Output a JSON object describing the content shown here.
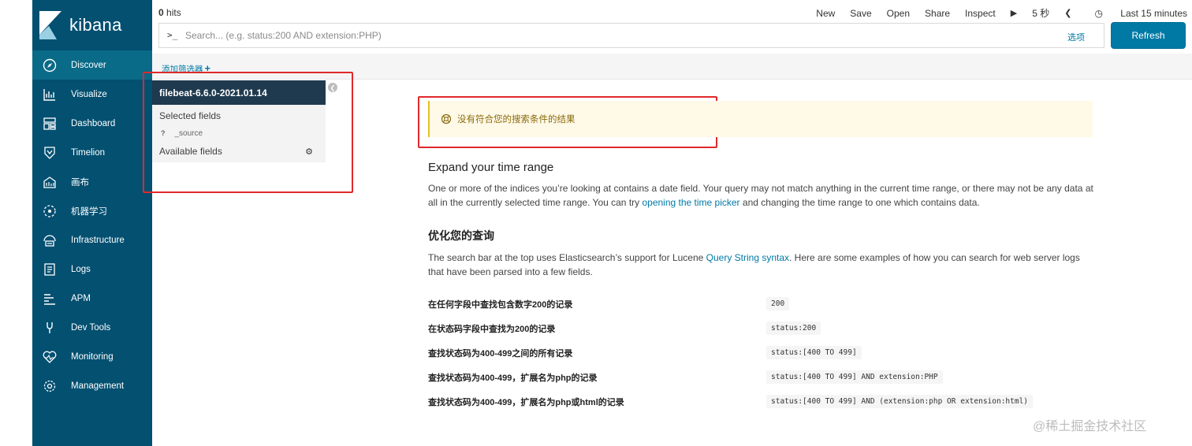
{
  "app": {
    "logo_text": "kibana"
  },
  "sidebar": {
    "items": [
      {
        "label": "Discover",
        "icon": "compass-icon"
      },
      {
        "label": "Visualize",
        "icon": "chart-icon"
      },
      {
        "label": "Dashboard",
        "icon": "dashboard-icon"
      },
      {
        "label": "Timelion",
        "icon": "shield-icon"
      },
      {
        "label": "画布",
        "icon": "canvas-icon"
      },
      {
        "label": "机器学习",
        "icon": "ml-icon"
      },
      {
        "label": "Infrastructure",
        "icon": "infrastructure-icon"
      },
      {
        "label": "Logs",
        "icon": "logs-icon"
      },
      {
        "label": "APM",
        "icon": "apm-icon"
      },
      {
        "label": "Dev Tools",
        "icon": "wrench-icon"
      },
      {
        "label": "Monitoring",
        "icon": "heartbeat-icon"
      },
      {
        "label": "Management",
        "icon": "gear-icon"
      }
    ]
  },
  "topbar": {
    "hits_count": "0",
    "hits_label": "hits",
    "menu": {
      "new": "New",
      "save": "Save",
      "open": "Open",
      "share": "Share",
      "inspect": "Inspect"
    },
    "refresh_interval": "5 秒",
    "time_range": "Last 15 minutes"
  },
  "search": {
    "prompt": ">_",
    "placeholder": "Search... (e.g. status:200 AND extension:PHP)",
    "options_label": "选项",
    "refresh_label": "Refresh"
  },
  "filter": {
    "add_label": "添加筛选器"
  },
  "fields": {
    "index_pattern": "filebeat-6.6.0-2021.01.14",
    "selected_heading": "Selected fields",
    "selected": [
      {
        "type": "?",
        "name": "_source"
      }
    ],
    "available_heading": "Available fields"
  },
  "results": {
    "no_results": "没有符合您的搜索条件的结果",
    "expand_title": "Expand your time range",
    "expand_text_1": "One or more of the indices you’re looking at contains a date field. Your query may not match anything in the current time range, or there may not be any data at all in the currently selected time range. You can try ",
    "expand_link": "opening the time picker",
    "expand_text_2": " and changing the time range to one which contains data.",
    "optimize_title": "优化您的查询",
    "optimize_text_1": "The search bar at the top uses Elasticsearch’s support for Lucene ",
    "optimize_link": "Query String syntax",
    "optimize_text_2": ". Here are some examples of how you can search for web server logs that have been parsed into a few fields.",
    "examples": [
      {
        "desc": "在任何字段中查找包含数字200的记录",
        "code": "200"
      },
      {
        "desc": "在状态码字段中查找为200的记录",
        "code": "status:200"
      },
      {
        "desc": "查找状态码为400-499之间的所有记录",
        "code": "status:[400 TO 499]"
      },
      {
        "desc": "查找状态码为400-499，扩展名为php的记录",
        "code": "status:[400 TO 499] AND extension:PHP"
      },
      {
        "desc": "查找状态码为400-499，扩展名为php或html的记录",
        "code": "status:[400 TO 499] AND (extension:php OR extension:html)"
      }
    ]
  },
  "watermark": {
    "text": "@稀土掘金技术社区"
  },
  "colors": {
    "sidebar": "#035071",
    "sidebar_active": "#0a6b88",
    "accent": "#0079a5",
    "highlight_box": "#e0292b",
    "callout_bg": "#fff9e8"
  }
}
